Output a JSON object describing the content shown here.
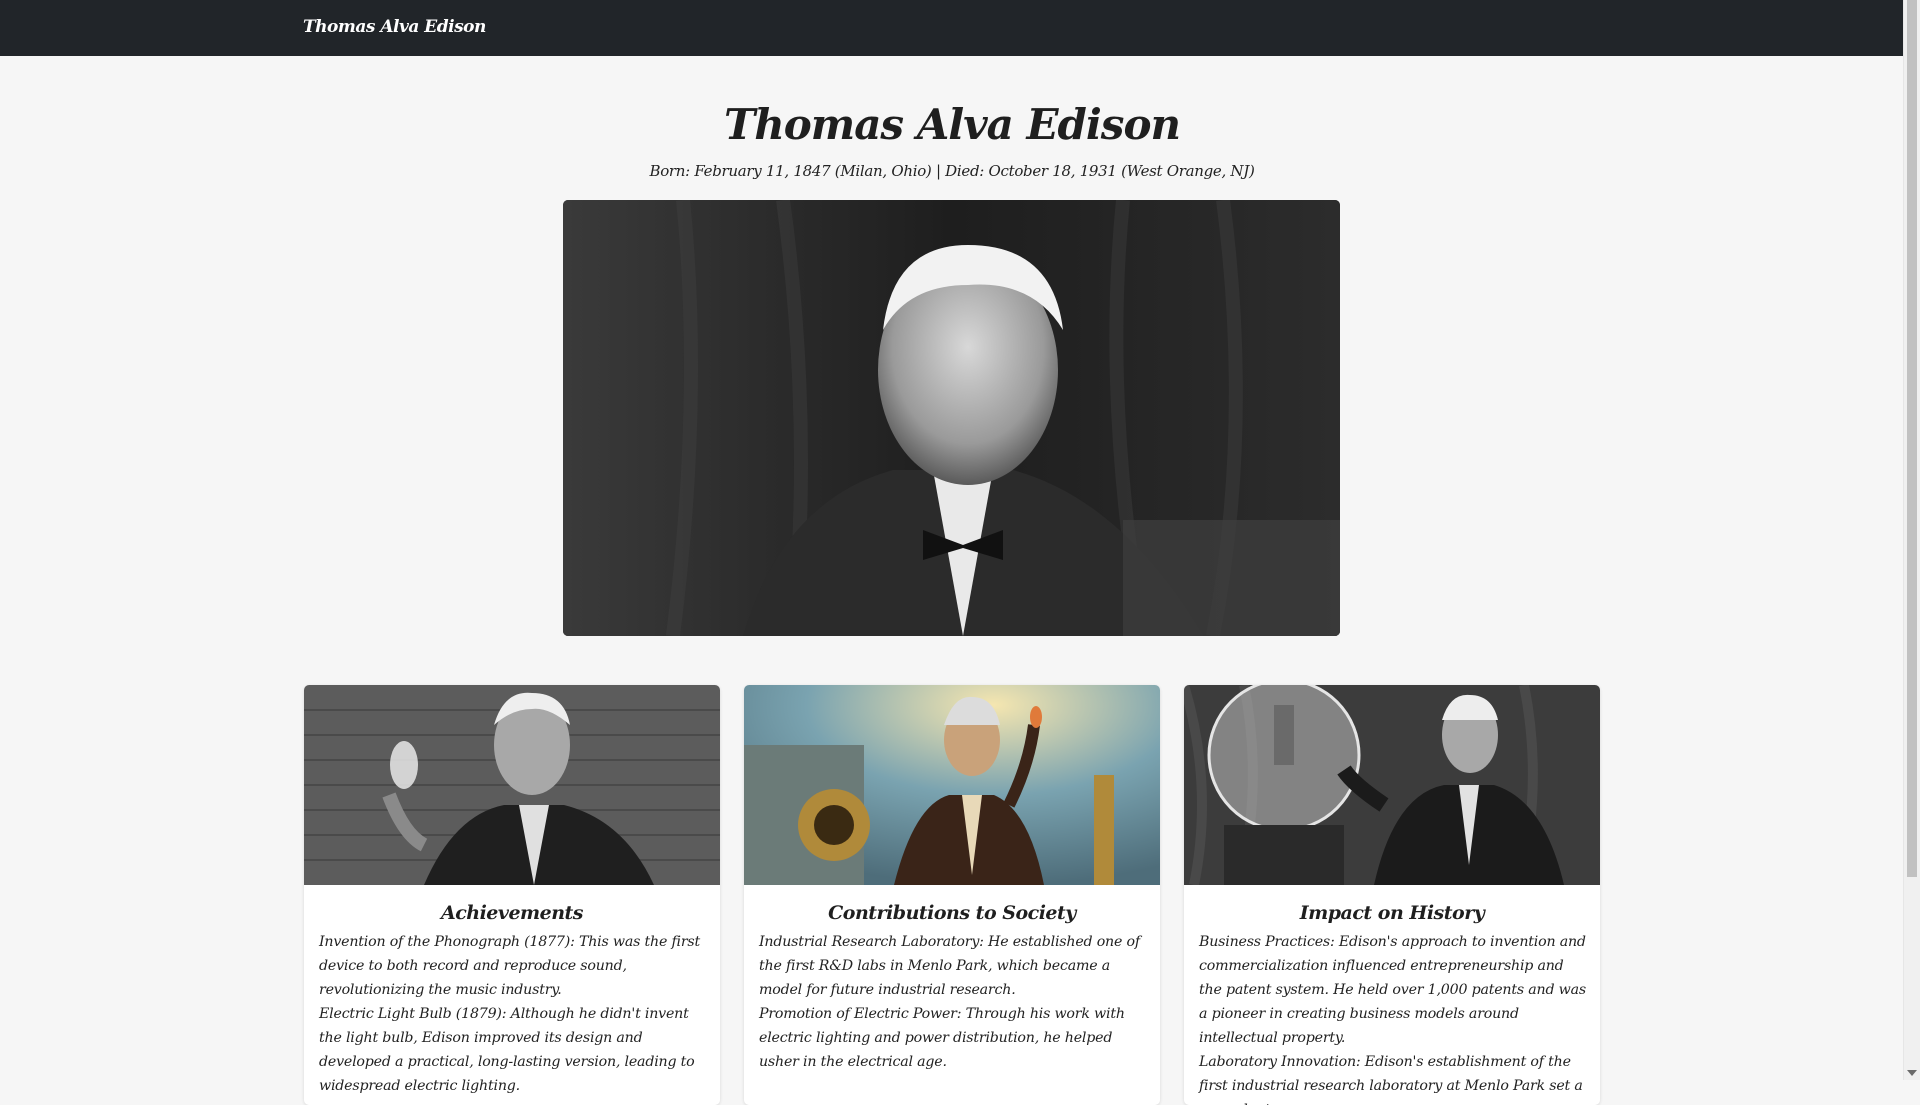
{
  "navbar": {
    "brand": "Thomas Alva Edison"
  },
  "header": {
    "title": "Thomas Alva Edison",
    "subtitle": "Born: February 11, 1847 (Milan, Ohio) | Died: October 18, 1931 (West Orange, NJ)"
  },
  "cards": [
    {
      "title": "Achievements",
      "paragraphs": [
        "Invention of the Phonograph (1877): This was the first device to both record and reproduce sound, revolutionizing the music industry.",
        "Electric Light Bulb (1879): Although he didn't invent the light bulb, Edison improved its design and developed a practical, long-lasting version, leading to widespread electric lighting."
      ]
    },
    {
      "title": "Contributions to Society",
      "paragraphs": [
        "Industrial Research Laboratory: He established one of the first R&D labs in Menlo Park, which became a model for future industrial research.",
        "Promotion of Electric Power: Through his work with electric lighting and power distribution, he helped usher in the electrical age."
      ]
    },
    {
      "title": "Impact on History",
      "paragraphs": [
        "Business Practices: Edison's approach to invention and commercialization influenced entrepreneurship and the patent system. He held over 1,000 patents and was a pioneer in creating business models around intellectual property.",
        "Laboratory Innovation: Edison's establishment of the first industrial research laboratory at Menlo Park set a precedent"
      ]
    }
  ]
}
